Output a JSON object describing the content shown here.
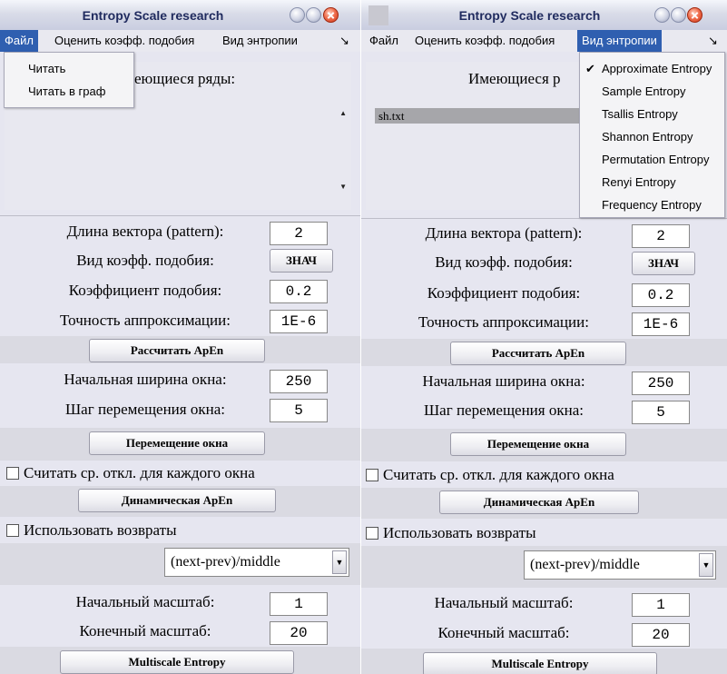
{
  "window_title": "Entropy Scale research",
  "menu": {
    "file": "Файл",
    "similarity": "Оценить коэфф. подобия",
    "entropy_type": "Вид энтропии",
    "overflow": "↘"
  },
  "file_menu_items": [
    "Читать",
    "Читать в граф"
  ],
  "entropy_menu": {
    "checked_mark": "✔",
    "items": [
      "Approximate Entropy",
      "Sample Entropy",
      "Tsallis Entropy",
      "Shannon Entropy",
      "Permutation Entropy",
      "Renyi Entropy",
      "Frequency Entropy"
    ]
  },
  "left": {
    "series_label_visible": "еющиеся ряды:"
  },
  "right": {
    "series_label_visible": "Имеющиеся р",
    "selected_series": "sh.txt"
  },
  "form": {
    "vector_length_label": "Длина вектора (pattern):",
    "vector_length_value": "2",
    "similarity_type_label": "Вид коэфф. подобия:",
    "similarity_type_button": "ЗНАЧ",
    "similarity_coef_label": "Коэффициент подобия:",
    "similarity_coef_value": "0.2",
    "approx_precision_label": "Точность аппроксимации:",
    "approx_precision_value": "1E-6",
    "calc_apen_button": "Рассчитать ApEn",
    "window_width_label": "Начальная ширина окна:",
    "window_width_value": "250",
    "window_step_label": "Шаг перемещения окна:",
    "window_step_value": "5",
    "move_window_button": "Перемещение окна",
    "stddev_checkbox_label": "Считать ср. откл. для каждого окна",
    "dynamic_apen_button": "Динамическая ApEn",
    "returns_checkbox_label": "Использовать возвраты",
    "returns_mode_value": "(next-prev)/middle",
    "start_scale_label": "Начальный масштаб:",
    "start_scale_value": "1",
    "end_scale_label": "Конечный масштаб:",
    "end_scale_value": "20",
    "multiscale_button": "Multiscale Entropy"
  }
}
